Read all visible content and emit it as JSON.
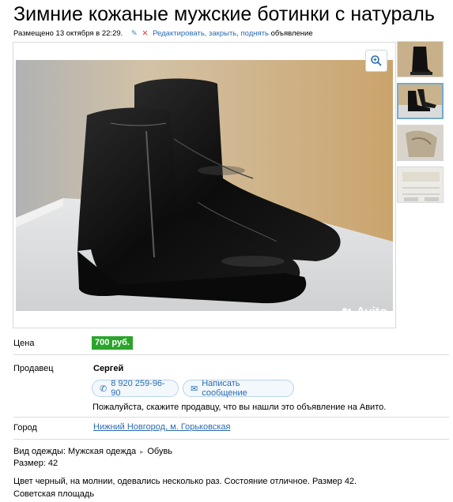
{
  "listing": {
    "title": "Зимние кожаные мужские ботинки с натураль",
    "posted": "Размещено 13 октября в 22:29.",
    "edit_link": "Редактировать, закрыть, поднять",
    "edit_suffix": "объявление"
  },
  "photo": {
    "watermark": "Avito"
  },
  "thumbnails": [
    {
      "id": "thumb-1",
      "active": false
    },
    {
      "id": "thumb-2",
      "active": true
    },
    {
      "id": "thumb-3",
      "active": false
    },
    {
      "id": "thumb-4",
      "active": false
    }
  ],
  "details": {
    "price_label": "Цена",
    "price_value": "700 руб.",
    "seller_label": "Продавец",
    "seller_name": "Сергей",
    "phone": "8 920 259-96-90",
    "message_button": "Написать сообщение",
    "seller_note": "Пожалуйста, скажите продавцу, что вы нашли это объявление на Авито.",
    "city_label": "Город",
    "city_value": "Нижний Новгород, м. Горьковская"
  },
  "attributes": {
    "category_prefix": "Вид одежды: Мужская одежда",
    "category_arrow": "▸",
    "category_leaf": "Обувь",
    "size": "Размер: 42"
  },
  "description": {
    "line1": "Цвет черный, на молнии, одевались несколько раз. Состояние отличное. Размер 42.",
    "line2": "Советская площадь"
  },
  "colors": {
    "link": "#2a6bb3",
    "price_bg": "#2ba42b"
  }
}
